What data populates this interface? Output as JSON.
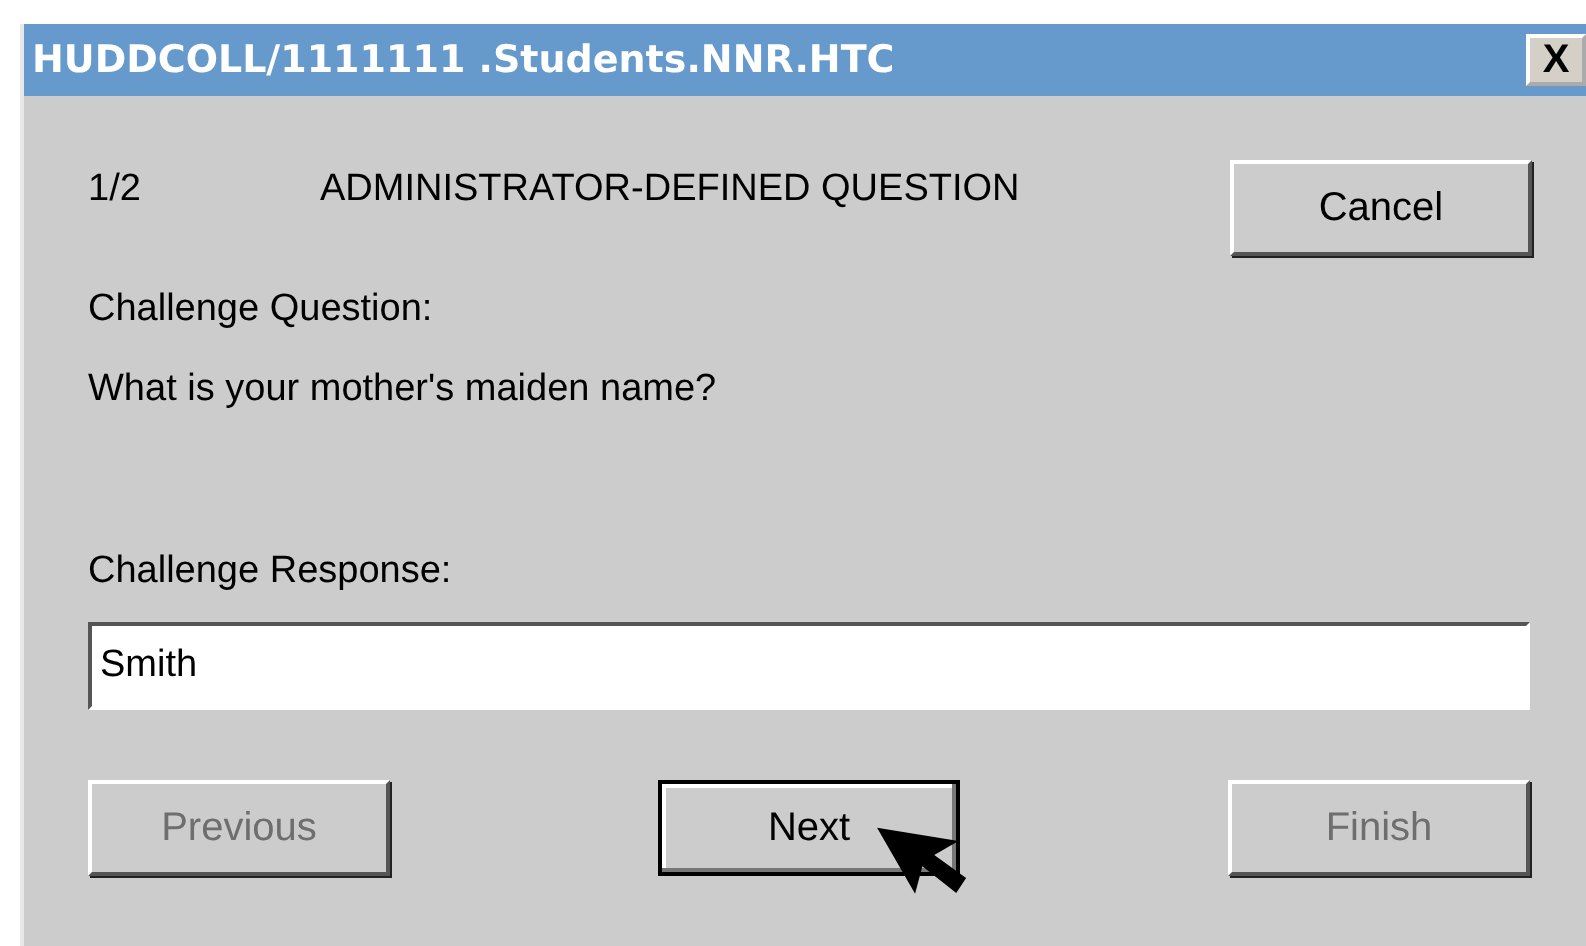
{
  "window": {
    "title": "HUDDCOLL/1111111 .Students.NNR.HTC",
    "close": "X"
  },
  "step": "1/2",
  "heading": "ADMINISTRATOR-DEFINED QUESTION",
  "cancel_button": {
    "label": "Cancel",
    "disabled": false,
    "default": false
  },
  "question_label": "Challenge Question:",
  "question": "What is your mother's maiden name?",
  "response_label": "Challenge Response:",
  "response_field": {
    "value": "Smith"
  },
  "buttons": [
    {
      "label": "Previous",
      "disabled": true,
      "default": false
    },
    {
      "label": "Next",
      "disabled": false,
      "default": true
    },
    {
      "label": "Finish",
      "disabled": true,
      "default": false
    }
  ]
}
